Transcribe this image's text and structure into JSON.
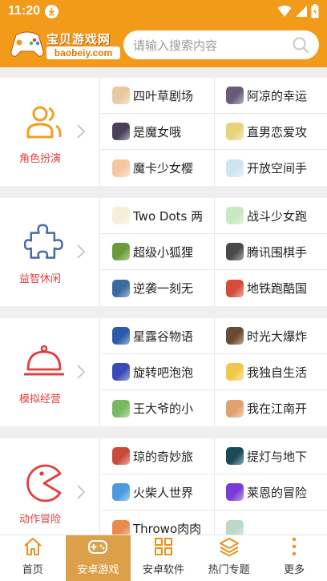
{
  "status_bar": {
    "time": "11:20"
  },
  "header": {
    "logo_title": "宝贝游戏网",
    "logo_domain": "baobeiy.com",
    "search_placeholder": "请输入搜索内容"
  },
  "categories": [
    {
      "name": "角色扮演",
      "icon": "person-icon",
      "games": [
        {
          "name": "四叶草剧场",
          "color": "#e8c9a0"
        },
        {
          "name": "阿凉的幸运",
          "color": "#6b5a78"
        },
        {
          "name": "是魔女哦",
          "color": "#4a3f5c"
        },
        {
          "name": "直男恋爱攻",
          "color": "#e8d27a"
        },
        {
          "name": "魔卡少女樱",
          "color": "#f4c7a0"
        },
        {
          "name": "开放空间手",
          "color": "#cfe3f0"
        }
      ]
    },
    {
      "name": "益智休闲",
      "icon": "puzzle-icon",
      "games": [
        {
          "name": "Two Dots 两",
          "color": "#f5efd8"
        },
        {
          "name": "战斗少女跑",
          "color": "#c7e8c0"
        },
        {
          "name": "超级小狐狸",
          "color": "#6b9a3a"
        },
        {
          "name": "腾讯围棋手",
          "color": "#4a4a4a"
        },
        {
          "name": "逆袭一刻无",
          "color": "#3a6aa0"
        },
        {
          "name": "地铁跑酷国",
          "color": "#d84a3a"
        }
      ]
    },
    {
      "name": "模拟经营",
      "icon": "food-cloche-icon",
      "games": [
        {
          "name": "星露谷物语",
          "color": "#2a5aa8"
        },
        {
          "name": "时光大爆炸",
          "color": "#6a4a30"
        },
        {
          "name": "旋转吧泡泡",
          "color": "#3a4ab8"
        },
        {
          "name": "我独自生活",
          "color": "#f0c848"
        },
        {
          "name": "王大爷的小",
          "color": "#7ab860"
        },
        {
          "name": "我在江南开",
          "color": "#e0a070"
        }
      ]
    },
    {
      "name": "动作冒险",
      "icon": "pacman-icon",
      "games": [
        {
          "name": "琼的奇妙旅",
          "color": "#c84a3a"
        },
        {
          "name": "提灯与地下",
          "color": "#1a4a5a"
        },
        {
          "name": "火柴人世界",
          "color": "#4a9ae0"
        },
        {
          "name": "莱恩的冒险",
          "color": "#7a3ad8"
        },
        {
          "name": "Throwo肉肉",
          "color": "#e88a4a"
        },
        {
          "name": "",
          "color": "#bcd8c8"
        }
      ]
    }
  ],
  "bottom_nav": [
    {
      "label": "首页",
      "icon": "home-icon",
      "active": false
    },
    {
      "label": "安卓游戏",
      "icon": "gamepad-icon",
      "active": true
    },
    {
      "label": "安卓软件",
      "icon": "apps-grid-icon",
      "active": false
    },
    {
      "label": "热门专题",
      "icon": "layers-icon",
      "active": false
    },
    {
      "label": "更多",
      "icon": "more-vertical-icon",
      "active": false
    }
  ],
  "colors": {
    "brand_orange": "#f29a1a",
    "category_accent": "#e53d3d",
    "active_nav": "#dca04a"
  }
}
